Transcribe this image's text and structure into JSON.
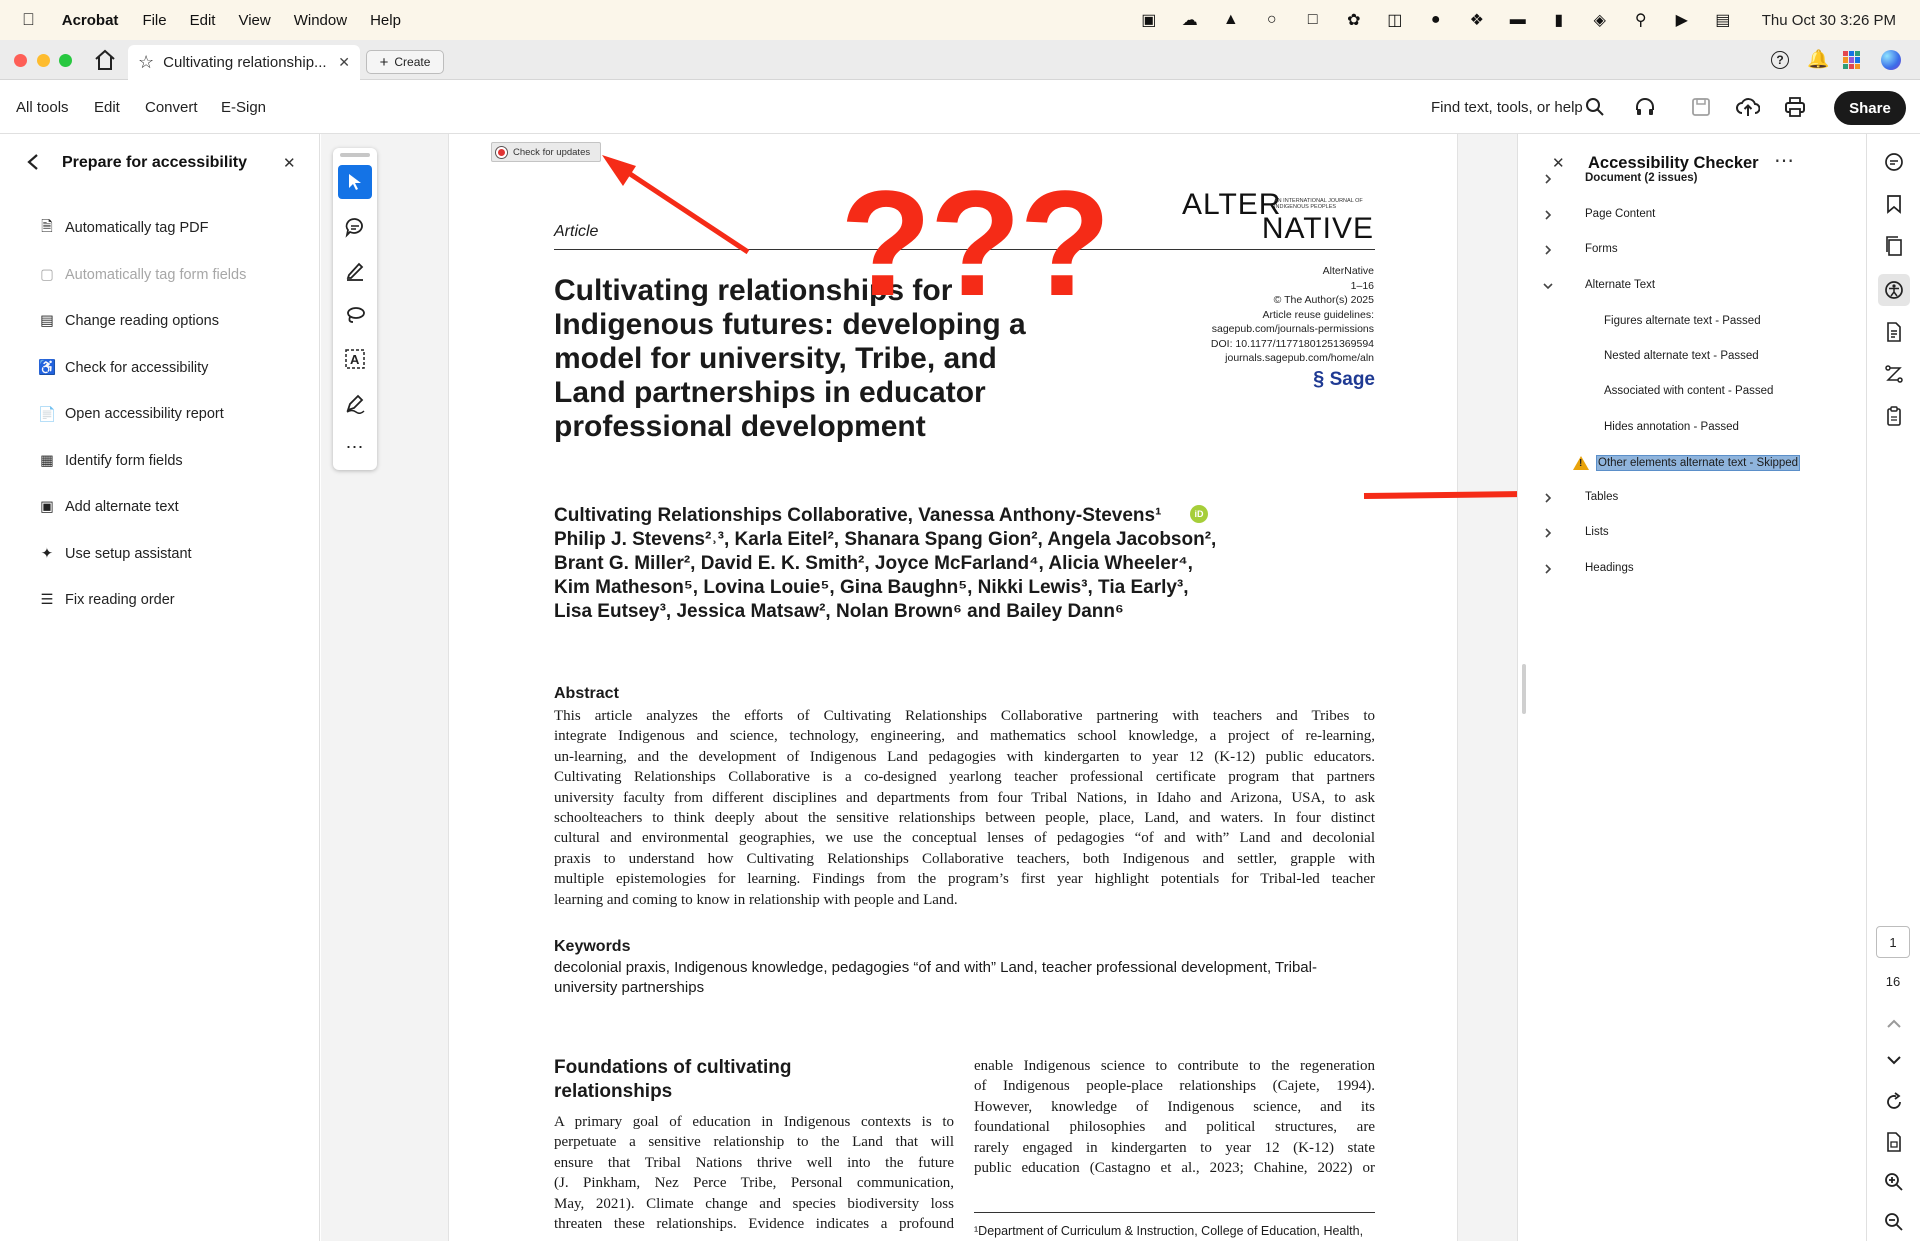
{
  "menubar": {
    "app": "Acrobat",
    "items": [
      "File",
      "Edit",
      "View",
      "Window",
      "Help"
    ],
    "clock": "Thu Oct 30  3:26 PM"
  },
  "tabbar": {
    "tab_title": "Cultivating relationship...",
    "create_label": "Create"
  },
  "toolbar": {
    "items": [
      "All tools",
      "Edit",
      "Convert",
      "E-Sign"
    ],
    "search_label": "Find text, tools, or help",
    "share_label": "Share"
  },
  "left_panel": {
    "title": "Prepare for accessibility",
    "items": [
      {
        "label": "Automatically tag PDF",
        "icon": "tag-pdf-icon",
        "disabled": false
      },
      {
        "label": "Automatically tag form fields",
        "icon": "tag-form-icon",
        "disabled": true
      },
      {
        "label": "Change reading options",
        "icon": "reading-options-icon",
        "disabled": false
      },
      {
        "label": "Check for accessibility",
        "icon": "accessibility-check-icon",
        "disabled": false
      },
      {
        "label": "Open accessibility report",
        "icon": "report-icon",
        "disabled": false
      },
      {
        "label": "Identify form fields",
        "icon": "form-fields-icon",
        "disabled": false
      },
      {
        "label": "Add alternate text",
        "icon": "alt-text-icon",
        "disabled": false
      },
      {
        "label": "Use setup assistant",
        "icon": "setup-assistant-icon",
        "disabled": false
      },
      {
        "label": "Fix reading order",
        "icon": "reading-order-icon",
        "disabled": false
      }
    ]
  },
  "check_updates": "Check for updates",
  "annotation_text": "???",
  "document": {
    "article_label": "Article",
    "journal_logo_top": "ALTER",
    "journal_logo_tag": "AN INTERNATIONAL JOURNAL OF INDIGENOUS PEOPLES",
    "journal_logo_bottom": "NATIVE",
    "meta": [
      "AlterNative",
      "1–16",
      "© The Author(s) 2025",
      "Article reuse guidelines:",
      "sagepub.com/journals-permissions",
      "DOI: 10.1177/11771801251369594",
      "journals.sagepub.com/home/aln"
    ],
    "publisher": "Sage",
    "title_lines": [
      "Cultivating relationships for",
      "Indigenous futures: developing a",
      "model for university, Tribe, and",
      "Land partnerships in educator",
      "professional development"
    ],
    "authors_lines": [
      "Cultivating Relationships Collaborative, Vanessa Anthony-Stevens¹",
      "Philip J. Stevens²˒³, Karla Eitel², Shanara Spang Gion², Angela Jacobson²,",
      "Brant G. Miller², David E. K. Smith², Joyce McFarland⁴, Alicia Wheeler⁴,",
      "Kim Matheson⁵, Lovina Louie⁵, Gina Baughn⁵, Nikki Lewis³, Tia Early³,",
      "Lisa Eutsey³, Jessica Matsaw², Nolan Brown⁶ and Bailey Dann⁶"
    ],
    "abstract_heading": "Abstract",
    "abstract_lines": [
      "This article analyzes the efforts of Cultivating Relationships Collaborative partnering with teachers and Tribes to",
      "integrate Indigenous and science, technology, engineering, and mathematics school knowledge, a project of re-learning,",
      "un-learning, and the development of Indigenous Land pedagogies with kindergarten to year 12 (K-12) public educators.",
      "Cultivating Relationships Collaborative is a co-designed yearlong teacher professional certificate program that partners",
      "university faculty from different disciplines and departments from four Tribal Nations, in Idaho and Arizona, USA, to ask",
      "schoolteachers to think deeply about the sensitive relationships between people, place, Land, and waters. In four distinct",
      "cultural and environmental geographies, we use the conceptual lenses of pedagogies “of and with” Land and decolonial",
      "praxis to understand how Cultivating Relationships Collaborative teachers, both Indigenous and settler, grapple with",
      "multiple epistemologies for learning. Findings from the program’s first year highlight potentials for Tribal-led teacher",
      "learning and coming to know in relationship with people and Land."
    ],
    "keywords_heading": "Keywords",
    "keywords_lines": [
      "decolonial praxis, Indigenous knowledge, pedagogies “of and with” Land, teacher professional development, Tribal-",
      "university partnerships"
    ],
    "section_heading_lines": [
      "Foundations of cultivating",
      "relationships"
    ],
    "col1_lines": [
      "A primary goal of education in Indigenous contexts is to",
      "perpetuate a sensitive relationship to the Land that will",
      "ensure that Tribal Nations thrive well into the future",
      "(J. Pinkham, Nez Perce Tribe, Personal communication,",
      "May, 2021). Climate change and species biodiversity loss",
      "threaten these relationships. Evidence indicates a profound"
    ],
    "col2_lines": [
      "enable Indigenous science to contribute to the regeneration",
      "of Indigenous people-place relationships (Cajete, 1994).",
      "However, knowledge of Indigenous science, and its",
      "foundational philosophies and political structures, are",
      "rarely engaged in kindergarten to year 12 (K-12) state",
      "public education (Castagno et al., 2023; Chahine, 2022) or"
    ],
    "footnote": "¹Department of Curriculum & Instruction, College of Education, Health,"
  },
  "right_panel": {
    "title": "Accessibility Checker",
    "rows": [
      {
        "label": "Document (2 issues)",
        "level": 0,
        "state": "collapsed",
        "bold": true
      },
      {
        "label": "Page Content",
        "level": 0,
        "state": "collapsed"
      },
      {
        "label": "Forms",
        "level": 0,
        "state": "collapsed"
      },
      {
        "label": "Alternate Text",
        "level": 0,
        "state": "expanded"
      },
      {
        "label": "Figures alternate text - Passed",
        "level": 1
      },
      {
        "label": "Nested alternate text - Passed",
        "level": 1
      },
      {
        "label": "Associated with content - Passed",
        "level": 1
      },
      {
        "label": "Hides annotation - Passed",
        "level": 1
      },
      {
        "label": "Other elements alternate text - Skipped",
        "level": 1,
        "warning": true,
        "selected": true
      },
      {
        "label": "Tables",
        "level": 0,
        "state": "collapsed"
      },
      {
        "label": "Lists",
        "level": 0,
        "state": "collapsed"
      },
      {
        "label": "Headings",
        "level": 0,
        "state": "collapsed"
      }
    ]
  },
  "page_nav": {
    "current": "1",
    "total": "16"
  },
  "colors": {
    "accent": "#1473e6",
    "annotation_red": "#f52b17",
    "selection": "#8fb4dc",
    "share_bg": "#1a1a1a"
  }
}
